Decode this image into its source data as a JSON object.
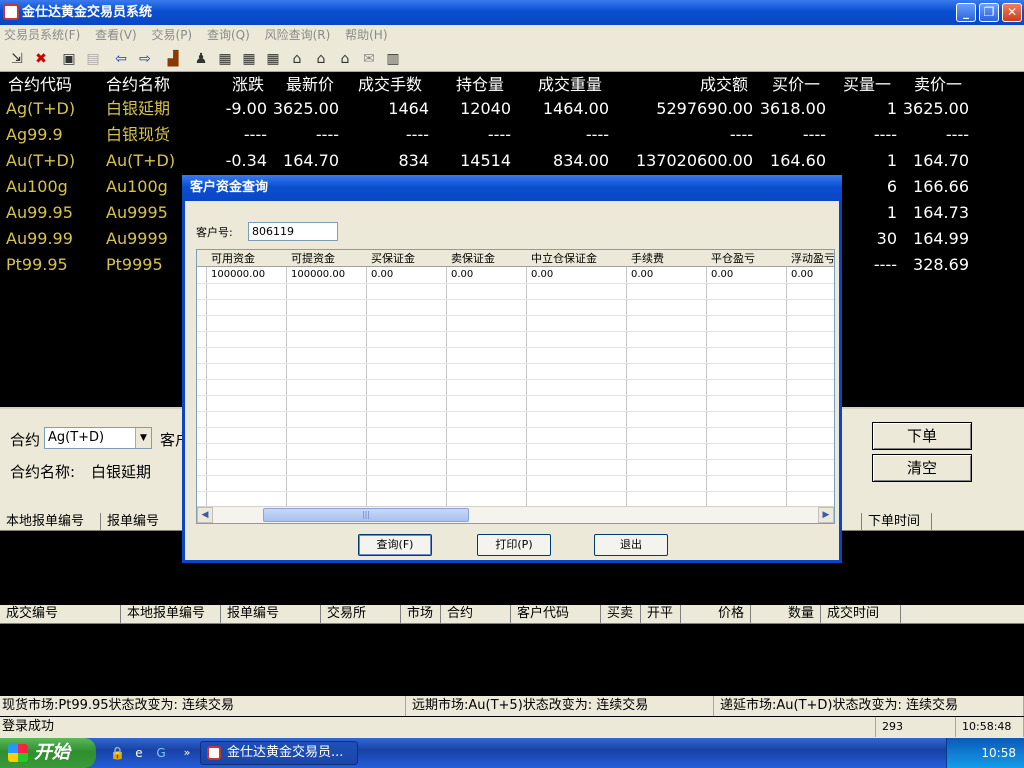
{
  "window": {
    "title": "金仕达黄金交易员系统"
  },
  "menu": [
    "交易员系统(F)",
    "查看(V)",
    "交易(P)",
    "查询(Q)",
    "风险查询(R)",
    "帮助(H)"
  ],
  "quotes": {
    "headers": [
      "合约代码",
      "合约名称",
      "涨跌",
      "最新价",
      "成交手数",
      "持仓量",
      "成交重量",
      "成交额",
      "买价一",
      "买量一",
      "卖价一"
    ],
    "rows": [
      {
        "code": "Ag(T+D)",
        "name": "白银延期",
        "change": "-9.00",
        "last": "3625.00",
        "volume": "1464",
        "oi": "12040",
        "weight": "1464.00",
        "amount": "5297690.00",
        "bid": "3618.00",
        "bidqty": "1",
        "ask": "3625.00"
      },
      {
        "code": "Ag99.9",
        "name": "白银现货",
        "change": "----",
        "last": "----",
        "volume": "----",
        "oi": "----",
        "weight": "----",
        "amount": "----",
        "bid": "----",
        "bidqty": "----",
        "ask": "----"
      },
      {
        "code": "Au(T+D)",
        "name": "Au(T+D)",
        "change": "-0.34",
        "last": "164.70",
        "volume": "834",
        "oi": "14514",
        "weight": "834.00",
        "amount": "137020600.00",
        "bid": "164.60",
        "bidqty": "1",
        "ask": "164.70"
      },
      {
        "code": "Au100g",
        "name": "Au100g",
        "bidqty": "6",
        "ask": "166.66"
      },
      {
        "code": "Au99.95",
        "name": "Au9995",
        "bidqty": "1",
        "ask": "164.73"
      },
      {
        "code": "Au99.99",
        "name": "Au9999",
        "bidqty": "30",
        "ask": "164.99"
      },
      {
        "code": "Pt99.95",
        "name": "Pt9995",
        "bidqty": "----",
        "ask": "328.69"
      }
    ]
  },
  "order": {
    "contract_label": "合约",
    "contract_value": "Ag(T+D)",
    "customer_label": "客户",
    "name_label": "合约名称:",
    "name_value": "白银延期",
    "submit": "下单",
    "clear": "清空"
  },
  "orders_table": {
    "headers": [
      "本地报单编号",
      "报单编号",
      "下单时间"
    ]
  },
  "trades_table": {
    "headers": [
      "成交编号",
      "本地报单编号",
      "报单编号",
      "交易所",
      "市场",
      "合约",
      "客户代码",
      "买卖",
      "开平",
      "价格",
      "数量",
      "成交时间"
    ]
  },
  "status": {
    "spot": "现货市场:Pt99.95状态改变为: 连续交易",
    "forward": "远期市场:Au(T+5)状态改变为: 连续交易",
    "deferred": "递延市场:Au(T+D)状态改变为: 连续交易",
    "login": "登录成功",
    "count": "293",
    "time": "10:58:48"
  },
  "dialog": {
    "title": "客户资金查询",
    "customer_label": "客户号:",
    "customer_value": "806119",
    "columns": [
      "可用资金",
      "可提资金",
      "买保证金",
      "卖保证金",
      "中立仓保证金",
      "手续费",
      "平仓盈亏",
      "浮动盈亏"
    ],
    "row": [
      "100000.00",
      "100000.00",
      "0.00",
      "0.00",
      "0.00",
      "0.00",
      "0.00",
      "0.00"
    ],
    "buttons": {
      "query": "查询(F)",
      "print": "打印(P)",
      "exit": "退出"
    }
  },
  "taskbar": {
    "start": "开始",
    "task": "金仕达黄金交易员...",
    "clock": "10:58"
  }
}
